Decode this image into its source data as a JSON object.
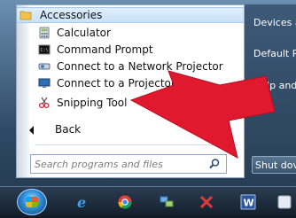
{
  "start_menu": {
    "folder": {
      "label": "Accessories",
      "icon": "folder-icon"
    },
    "items": [
      {
        "label": "Calculator",
        "icon": "calculator-icon"
      },
      {
        "label": "Command Prompt",
        "icon": "command-prompt-icon"
      },
      {
        "label": "Connect to a Network Projector",
        "icon": "network-projector-icon"
      },
      {
        "label": "Connect to a Projector",
        "icon": "projector-icon"
      },
      {
        "label": "Snipping Tool",
        "icon": "scissors-icon"
      }
    ],
    "back_label": "Back",
    "search": {
      "placeholder": "Search programs and files",
      "icon": "magnifier-icon"
    }
  },
  "right_pane": {
    "items": [
      "Devices a",
      "Default P",
      "Help and"
    ],
    "shutdown_label": "Shut dov"
  },
  "taskbar": {
    "icons": [
      "start-orb-icon",
      "internet-explorer-icon",
      "chrome-icon",
      "network-icon",
      "close-icon",
      "word-icon",
      "app-icon"
    ]
  },
  "colors": {
    "arrow": "#e0192f",
    "highlight": "#cfe4fa"
  }
}
